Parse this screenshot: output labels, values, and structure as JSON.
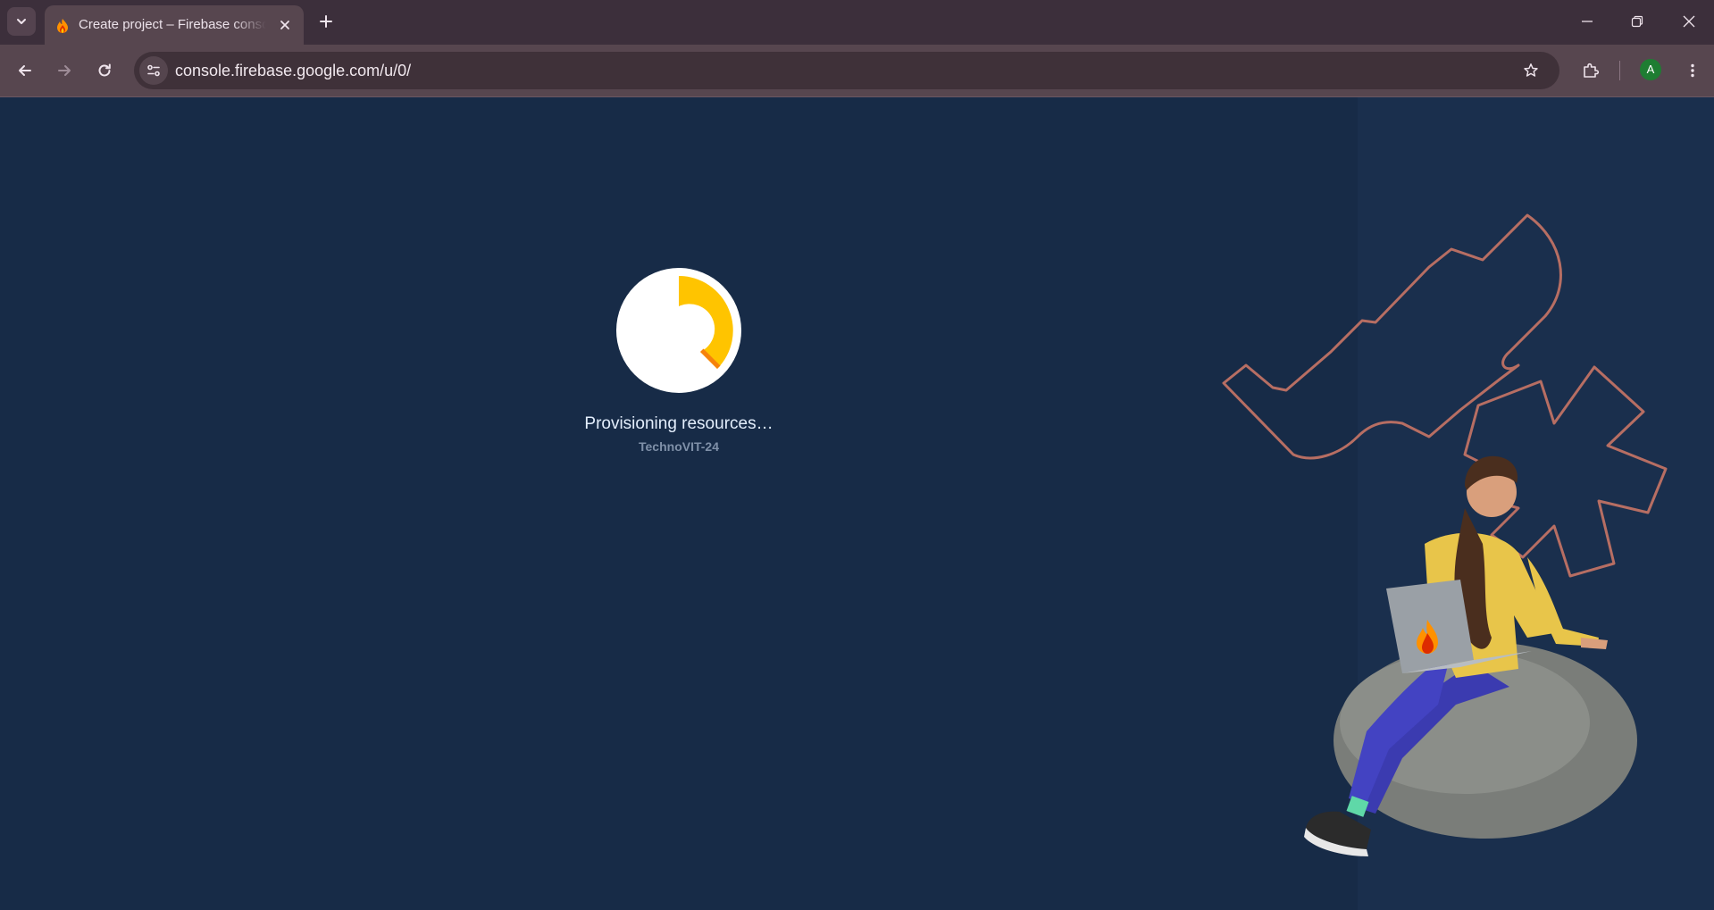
{
  "browser": {
    "tab": {
      "title": "Create project – Firebase console",
      "favicon": "firebase-flame-icon"
    },
    "address_bar": {
      "url": "console.firebase.google.com/u/0/"
    },
    "profile_initial": "A",
    "colors": {
      "titlebar": "#3c2f3b",
      "toolbar": "#57464f",
      "omnibox": "#3f3139",
      "avatar": "#1e7d32"
    },
    "icons": [
      "tab-search-icon",
      "close-icon",
      "plus-icon",
      "minimize-icon",
      "restore-icon",
      "window-close-icon",
      "back-icon",
      "forward-icon",
      "reload-icon",
      "site-info-icon",
      "bookmark-star-icon",
      "extensions-icon",
      "more-menu-icon"
    ]
  },
  "page": {
    "status": "Provisioning resources…",
    "project_name": "TechnoVIT-24",
    "colors": {
      "background": "#172b47",
      "spinner_track": "#ffffff",
      "spinner_arc": "#ffc400",
      "spinner_arc_tip": "#f6820c",
      "decor_outline": "#b76e63"
    }
  }
}
